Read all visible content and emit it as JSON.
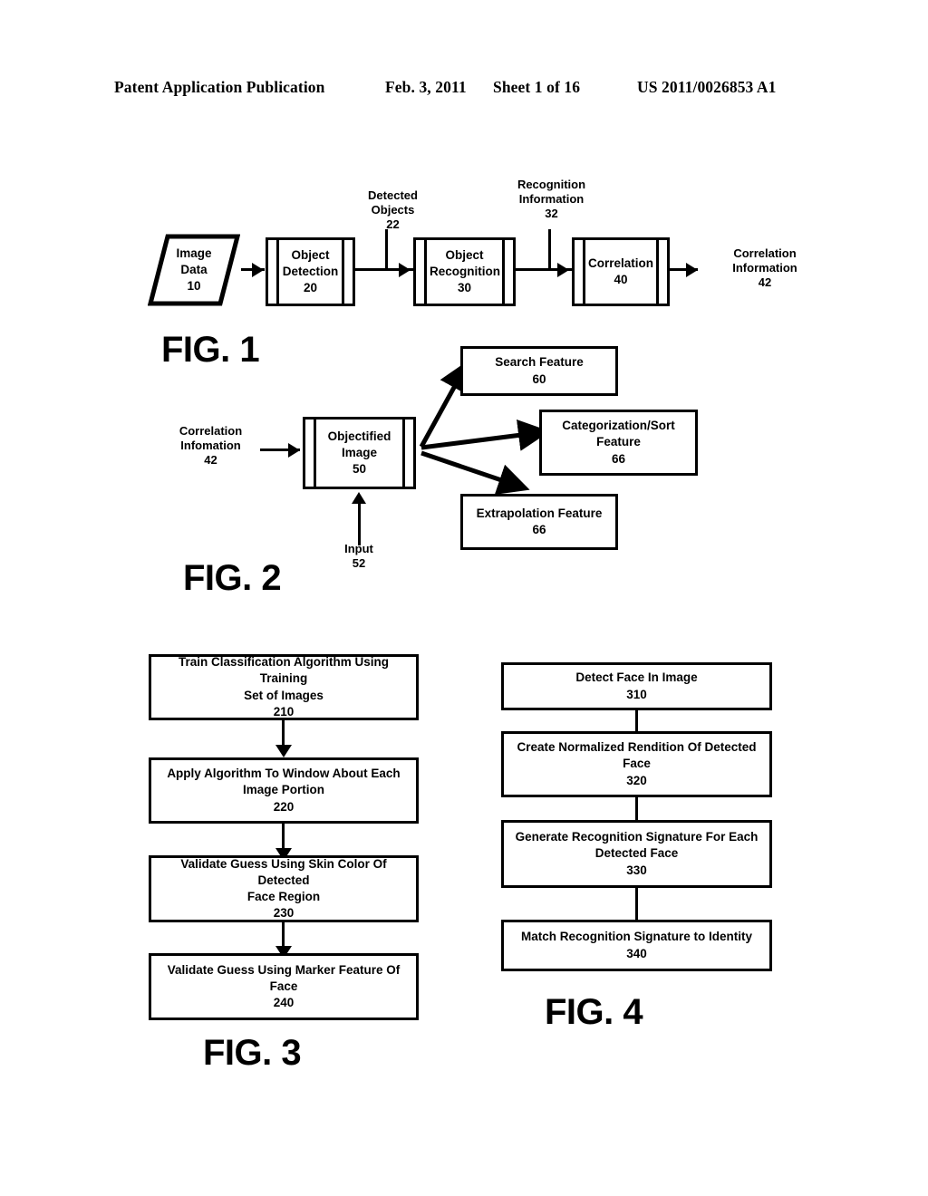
{
  "header": {
    "title": "Patent Application Publication",
    "date": "Feb. 3, 2011",
    "sheet": "Sheet 1 of 16",
    "publication_number": "US 2011/0026853 A1"
  },
  "figures": [
    {
      "caption": "FIG. 1",
      "nodes": [
        {
          "shape": "parallelogram",
          "label": "Image\nData",
          "ref": "10"
        },
        {
          "shape": "predefined-process",
          "label": "Object\nDetection",
          "ref": "20"
        },
        {
          "shape": "predefined-process",
          "label": "Object\nRecognition",
          "ref": "30"
        },
        {
          "shape": "predefined-process",
          "label": "Correlation",
          "ref": "40"
        }
      ],
      "callouts": [
        {
          "label": "Detected\nObjects",
          "ref": "22"
        },
        {
          "label": "Recognition\nInformation",
          "ref": "32"
        },
        {
          "label": "Correlation\nInformation",
          "ref": "42"
        }
      ]
    },
    {
      "caption": "FIG. 2",
      "nodes": [
        {
          "shape": "predefined-process",
          "label": "Objectified\nImage",
          "ref": "50"
        },
        {
          "shape": "rect",
          "label": "Search Feature",
          "ref": "60"
        },
        {
          "shape": "rect",
          "label": "Categorization/Sort\nFeature",
          "ref": "66"
        },
        {
          "shape": "rect",
          "label": "Extrapolation Feature",
          "ref": "66"
        }
      ],
      "callouts": [
        {
          "label": "Correlation\nInfomation",
          "ref": "42"
        },
        {
          "label": "Input",
          "ref": "52"
        }
      ]
    },
    {
      "caption": "FIG. 3",
      "steps": [
        {
          "label": "Train Classification Algorithm Using Training\nSet of Images",
          "ref": "210"
        },
        {
          "label": "Apply Algorithm To Window About Each\nImage Portion",
          "ref": "220"
        },
        {
          "label": "Validate Guess Using Skin Color Of Detected\nFace Region",
          "ref": "230"
        },
        {
          "label": "Validate Guess Using Marker Feature Of\nFace",
          "ref": "240"
        }
      ]
    },
    {
      "caption": "FIG. 4",
      "steps": [
        {
          "label": "Detect Face In Image",
          "ref": "310"
        },
        {
          "label": "Create Normalized Rendition Of Detected\nFace",
          "ref": "320"
        },
        {
          "label": "Generate Recognition Signature For Each\nDetected Face",
          "ref": "330"
        },
        {
          "label": "Match Recognition Signature to Identity",
          "ref": "340"
        }
      ]
    }
  ],
  "colors": {
    "ink": "#000000",
    "paper": "#ffffff"
  }
}
